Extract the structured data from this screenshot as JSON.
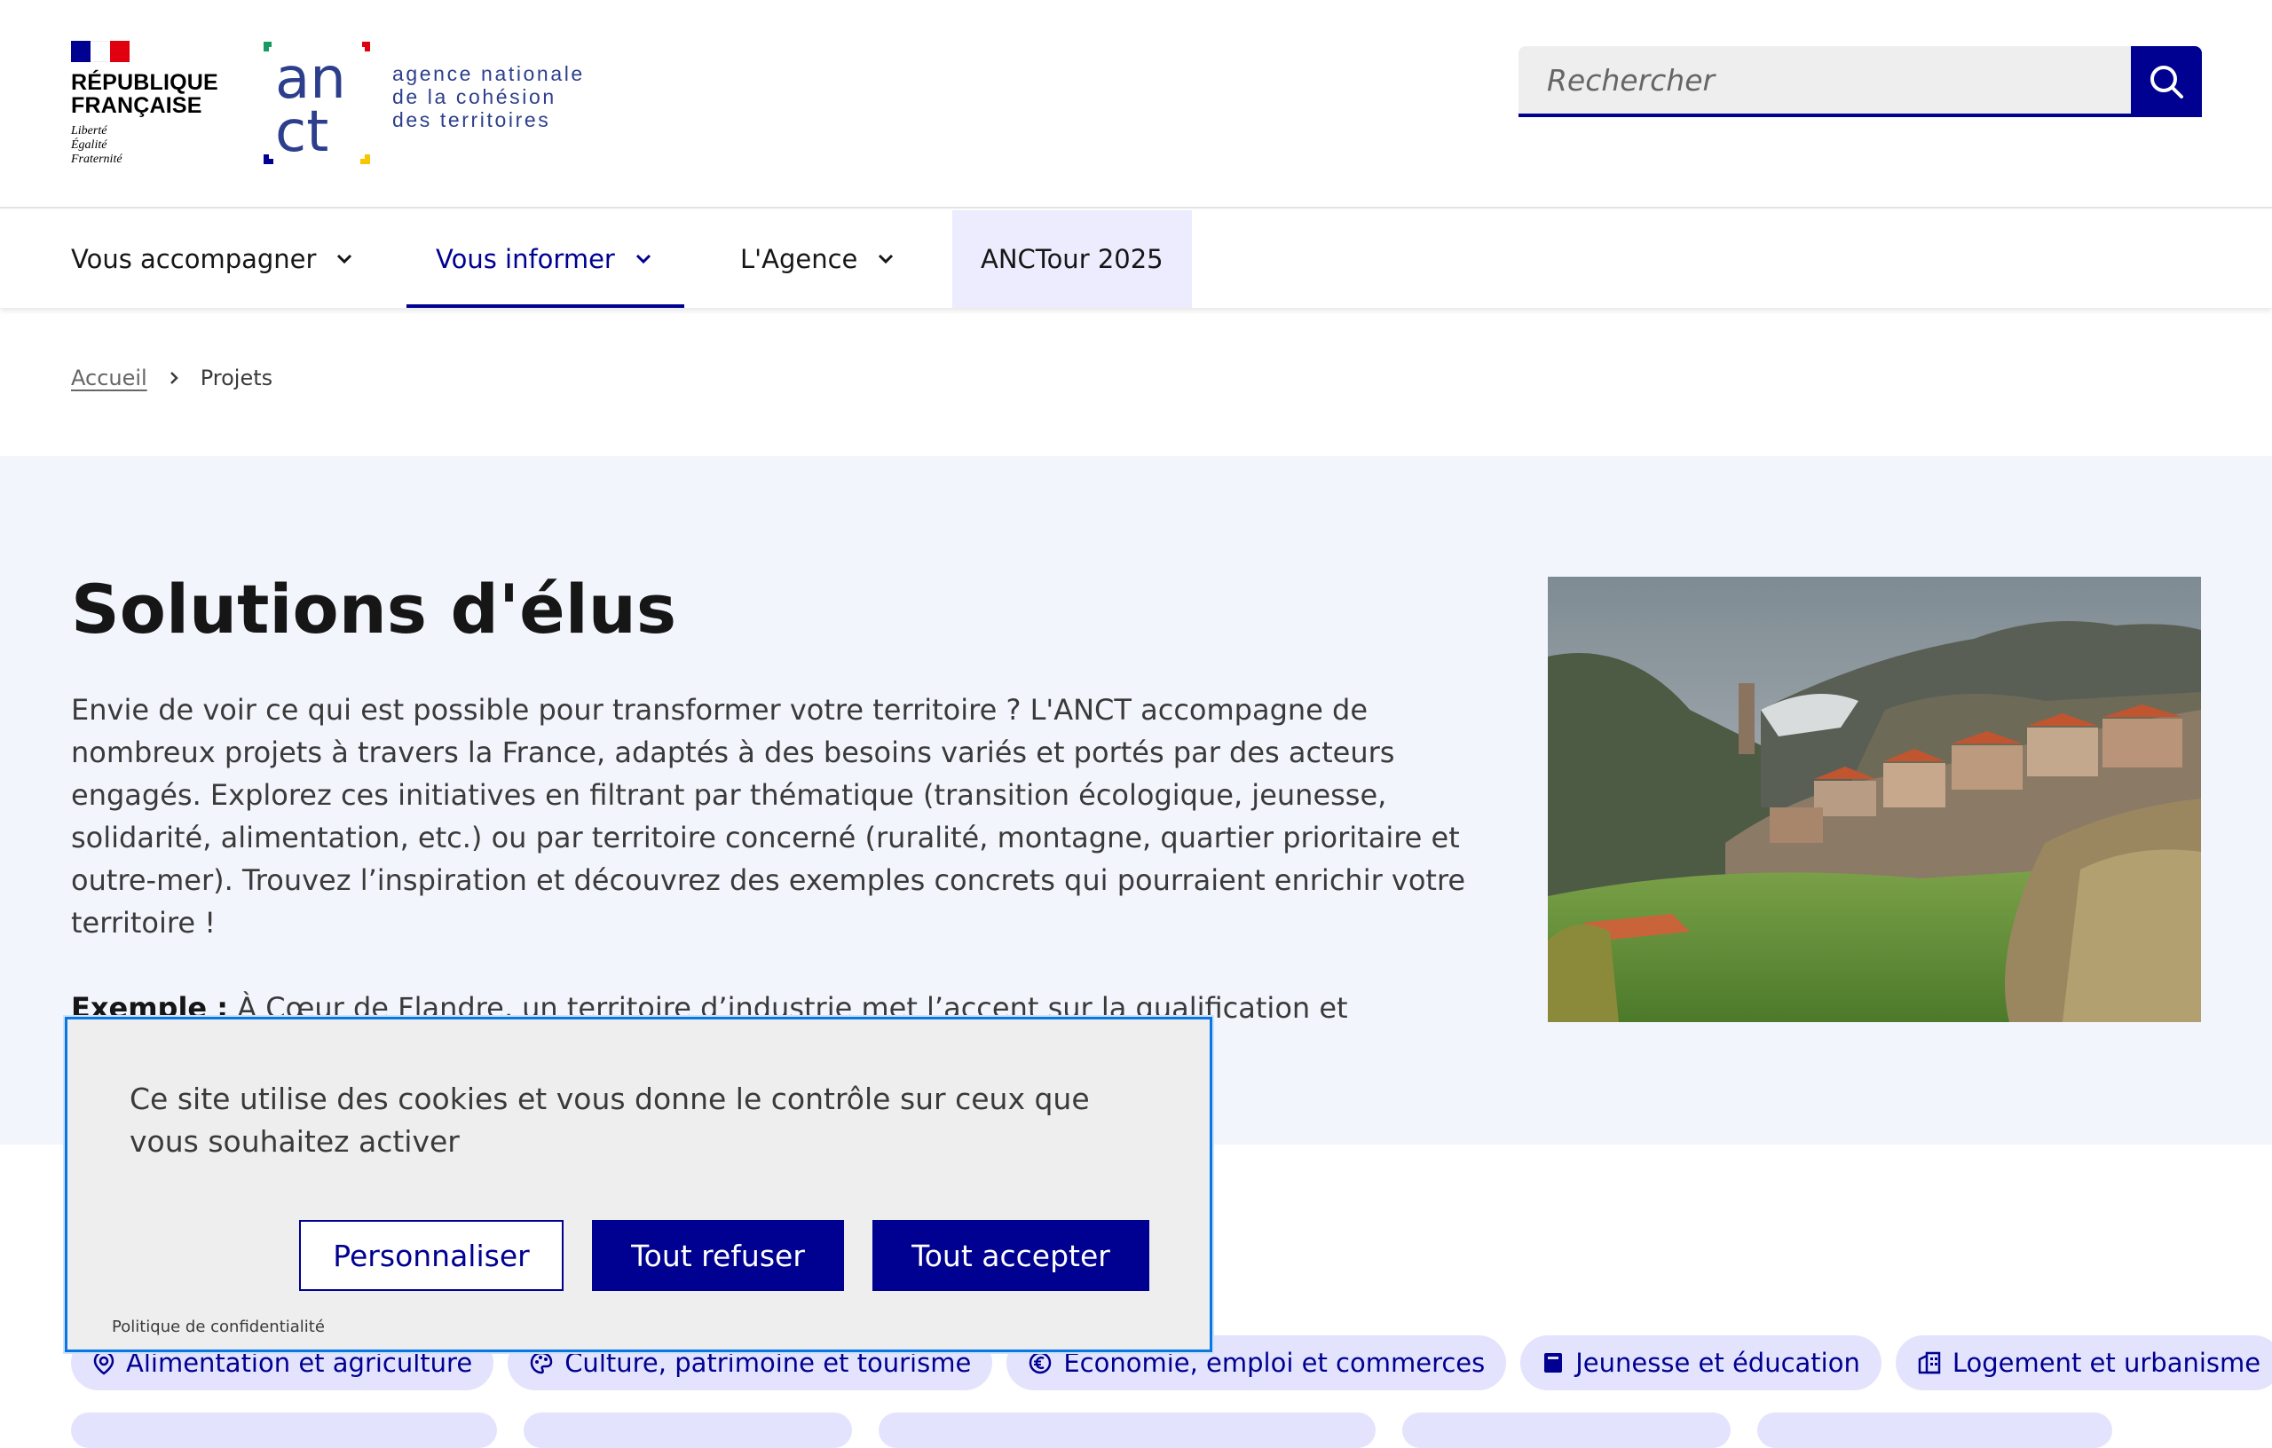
{
  "header": {
    "gov": {
      "name_line1": "RÉPUBLIQUE",
      "name_line2": "FRANÇAISE",
      "motto1": "Liberté",
      "motto2": "Égalité",
      "motto3": "Fraternité"
    },
    "agency": {
      "logo_line1": "an",
      "logo_line2": "ct",
      "name_line1": "agence nationale",
      "name_line2": "de la cohésion",
      "name_line3": "des territoires"
    },
    "search": {
      "placeholder": "Rechercher",
      "button_icon": "search-icon"
    }
  },
  "nav": {
    "items": [
      {
        "label": "Vous accompagner",
        "icon": "chevron-down-icon"
      },
      {
        "label": "Vous informer",
        "icon": "chevron-down-icon",
        "active": true
      },
      {
        "label": "L'Agence",
        "icon": "chevron-down-icon"
      },
      {
        "label": "ANCTour 2025"
      }
    ]
  },
  "breadcrumb": {
    "home": "Accueil",
    "current": "Projets"
  },
  "hero": {
    "title": "Solutions d'élus",
    "intro": "Envie de voir ce qui est possible pour transformer votre territoire ? L'ANCT accompagne de nombreux projets à travers la France, adaptés à des besoins variés et portés par des acteurs engagés. Explorez ces initiatives en filtrant par thématique (transition écologique, jeunesse, solidarité, alimentation, etc.) ou par territoire concerné (ruralité, montagne, quartier prioritaire et outre-mer). Trouvez l’inspiration et découvrez des exemples concrets qui pourraient enrichir votre territoire !",
    "example_label": "Exemple :",
    "example_text": " À Cœur de Flandre, un territoire d’industrie met l’accent sur la qualification et l’innovation, dynamisant ainsi l’économie locale et renforçant les savoir-faire."
  },
  "tags": [
    {
      "label": "Alimentation et agriculture",
      "icon": "map-pin-icon"
    },
    {
      "label": "Culture, patrimoine et tourisme",
      "icon": "palette-icon"
    },
    {
      "label": "Économie, emploi et commerces",
      "icon": "euro-icon"
    },
    {
      "label": "Jeunesse et éducation",
      "icon": "book-icon"
    },
    {
      "label": "Logement et urbanisme",
      "icon": "building-icon"
    }
  ],
  "cookie": {
    "message": "Ce site utilise des cookies et vous donne le contrôle sur ceux que vous souhaitez activer",
    "customize": "Personnaliser",
    "refuse": "Tout refuser",
    "accept": "Tout accepter",
    "policy": "Politique de confidentialité"
  },
  "colors": {
    "primary": "#000091",
    "hero_bg": "#f3f5fd",
    "tag_bg": "#e3e3fd",
    "cookie_border": "#0a76e3"
  }
}
